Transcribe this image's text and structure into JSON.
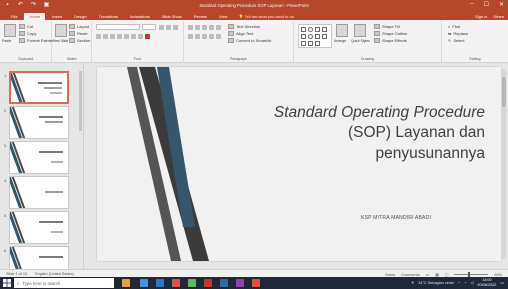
{
  "window": {
    "title": "Standard Operating Procedure SOP Layanan - PowerPoint",
    "controls": [
      "–",
      "☐",
      "✕"
    ]
  },
  "tabs": [
    {
      "label": "File"
    },
    {
      "label": "Home",
      "active": true
    },
    {
      "label": "Insert"
    },
    {
      "label": "Design"
    },
    {
      "label": "Transitions"
    },
    {
      "label": "Animations"
    },
    {
      "label": "Slide Show"
    },
    {
      "label": "Review"
    },
    {
      "label": "View"
    }
  ],
  "tell_me": "Tell me what you want to do",
  "account": {
    "signin": "Sign in",
    "share": "Share"
  },
  "ribbon": {
    "clipboard": {
      "paste": "Paste",
      "cut": "Cut",
      "copy": "Copy",
      "format_painter": "Format Painter",
      "label": "Clipboard"
    },
    "slides": {
      "new_slide": "New Slide",
      "layout": "Layout",
      "reset": "Reset",
      "section": "Section",
      "label": "Slides"
    },
    "font": {
      "label": "Font"
    },
    "paragraph": {
      "text_direction": "Text Direction",
      "align_text": "Align Text",
      "smartart": "Convert to SmartArt",
      "label": "Paragraph"
    },
    "drawing": {
      "arrange": "Arrange",
      "quick_styles": "Quick Styles",
      "shape_fill": "Shape Fill",
      "shape_outline": "Shape Outline",
      "shape_effects": "Shape Effects",
      "label": "Drawing"
    },
    "editing": {
      "find": "Find",
      "replace": "Replace",
      "select": "Select",
      "label": "Editing"
    }
  },
  "thumbnails": [
    {
      "number": "1",
      "active": true
    },
    {
      "number": "2"
    },
    {
      "number": "3"
    },
    {
      "number": "4"
    },
    {
      "number": "5"
    },
    {
      "number": "6"
    }
  ],
  "slide": {
    "title_line1": "Standard Operating Procedure",
    "title_line2": "(SOP) Layanan dan",
    "title_line3": "penyusunannya",
    "subtitle": "KSP MITRA MANDIRI ABADI",
    "colors": {
      "background": "#f1f1f1",
      "accent_blue": "#36566b",
      "accent_dark": "#3b3b3b"
    }
  },
  "statusbar": {
    "slide_info": "Slide 1 of 15",
    "language": "English (United States)",
    "notes": "Notes",
    "comments": "Comments",
    "zoom": "69%"
  },
  "taskbar": {
    "search_placeholder": "Type here to search",
    "weather": "31°C Sebagian cerah",
    "time": "13:00",
    "date": "20/06/2022"
  }
}
